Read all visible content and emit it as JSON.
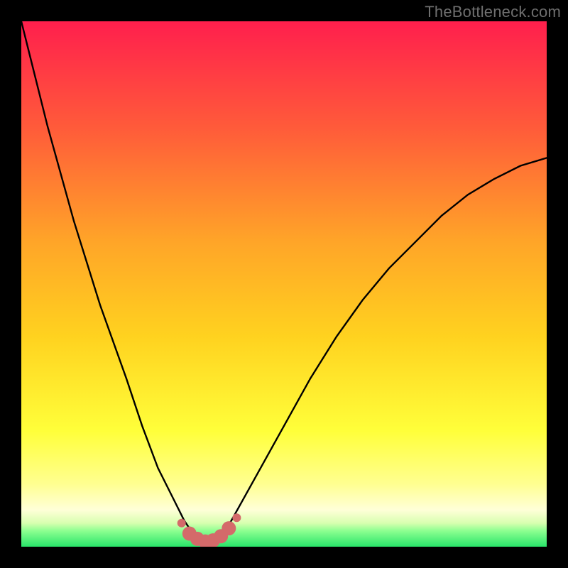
{
  "watermark": "TheBottleneck.com",
  "colors": {
    "background": "#000000",
    "gradient_top": "#ff1f4d",
    "gradient_mid_upper": "#ff7a2a",
    "gradient_mid": "#ffd21f",
    "gradient_mid_lower": "#ffff3a",
    "gradient_lower_pale": "#ffffc0",
    "gradient_bottom": "#29ff76",
    "curve": "#000000",
    "marker": "#d46a6a"
  },
  "chart_data": {
    "type": "line",
    "title": "",
    "xlabel": "",
    "ylabel": "",
    "xlim": [
      0,
      100
    ],
    "ylim": [
      0,
      100
    ],
    "series": [
      {
        "name": "bottleneck-curve",
        "x": [
          0,
          5,
          10,
          15,
          20,
          23,
          26,
          29,
          31,
          33,
          34.5,
          36,
          38,
          40,
          45,
          50,
          55,
          60,
          65,
          70,
          75,
          80,
          85,
          90,
          95,
          100
        ],
        "values": [
          100,
          80,
          62,
          46,
          32,
          23,
          15,
          9,
          5,
          2,
          1,
          1,
          2,
          5,
          14,
          23,
          32,
          40,
          47,
          53,
          58,
          63,
          67,
          70,
          72.5,
          74
        ]
      }
    ],
    "markers": {
      "name": "highlighted-range",
      "x": [
        30.5,
        32,
        33.5,
        35,
        36.5,
        38,
        39.5,
        41
      ],
      "values": [
        4.5,
        2.5,
        1.5,
        1,
        1.2,
        2,
        3.5,
        5.5
      ]
    }
  }
}
